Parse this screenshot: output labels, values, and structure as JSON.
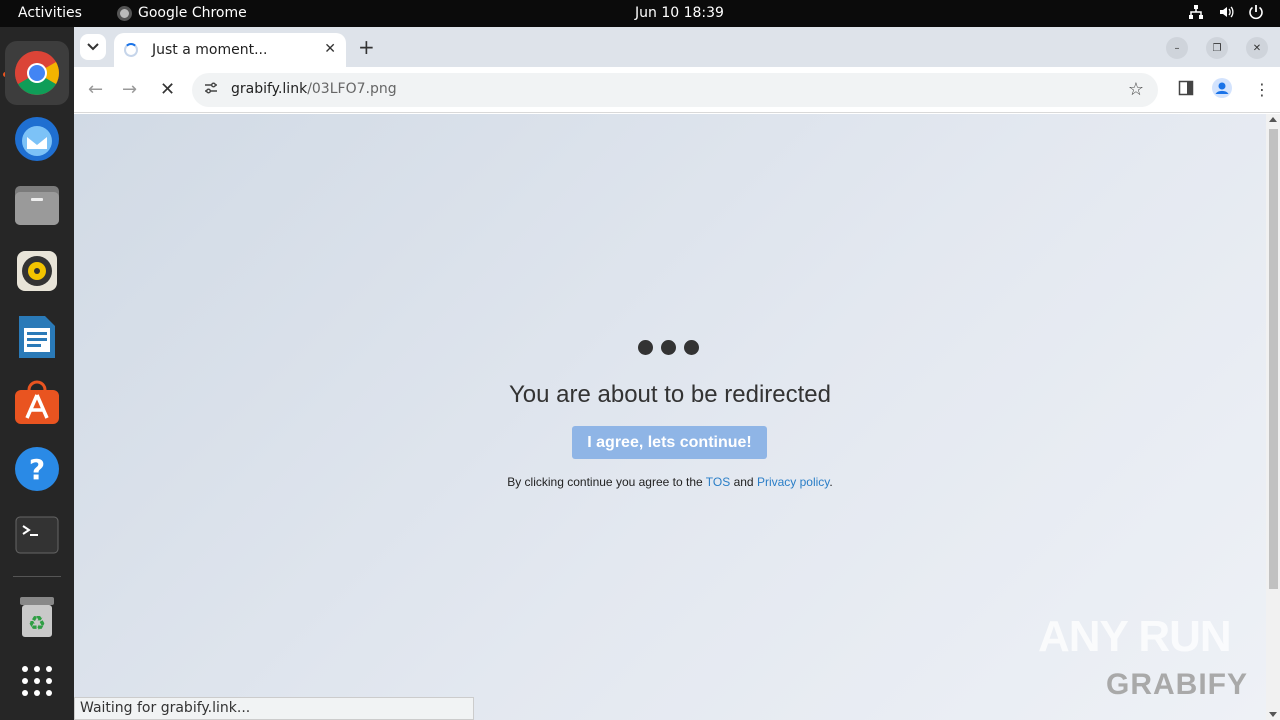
{
  "topbar": {
    "activities": "Activities",
    "app_name": "Google Chrome",
    "clock": "Jun 10  18:39"
  },
  "dock": {
    "apps": [
      "Google Chrome",
      "Thunderbird",
      "Files",
      "Rhythmbox",
      "LibreOffice Writer",
      "Ubuntu Software",
      "Help",
      "Terminal",
      "Trash",
      "Show Applications"
    ]
  },
  "browser": {
    "tab_title": "Just a moment...",
    "url_host": "grabify.link",
    "url_path": "/03LFO7.png"
  },
  "page": {
    "headline": "You are about to be redirected",
    "agree_button": "I agree, lets continue!",
    "legal_prefix": "By clicking continue you agree to the ",
    "tos_link": "TOS",
    "legal_and": " and ",
    "privacy_link": "Privacy policy",
    "legal_suffix": "."
  },
  "watermark": {
    "anyrun": "ANY RUN",
    "grabify": "GRABIFY"
  },
  "status_bar": "Waiting for grabify.link...",
  "colors": {
    "accent": "#1a73e8",
    "button": "#8fb5e6",
    "link": "#2a7ec7"
  }
}
